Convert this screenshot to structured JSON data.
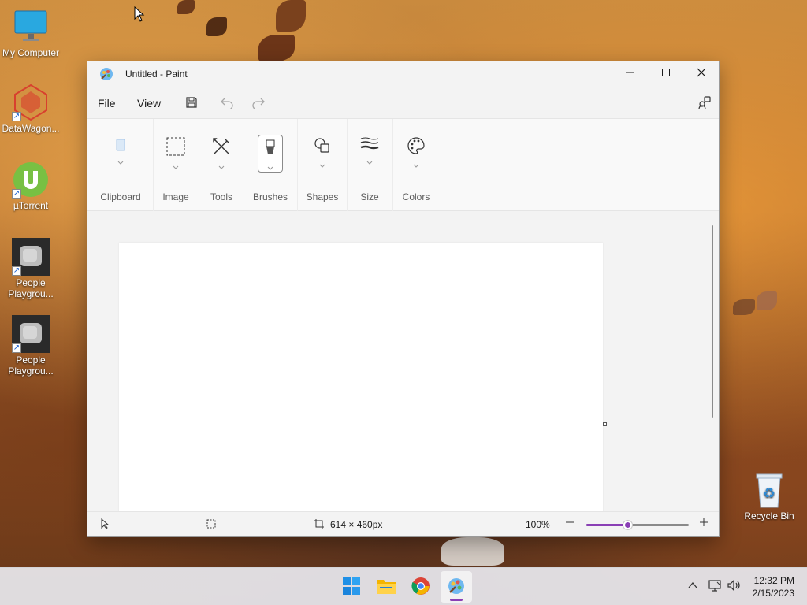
{
  "desktop": {
    "icons": [
      {
        "label": "My Computer",
        "icon": "monitor-icon"
      },
      {
        "label": "DataWagon...",
        "icon": "datawagon-icon"
      },
      {
        "label": "µTorrent",
        "icon": "utorrent-icon"
      },
      {
        "label": "People Playgrou...",
        "icon": "game-icon"
      },
      {
        "label": "People Playgrou...",
        "icon": "game-icon"
      },
      {
        "label": "Recycle Bin",
        "icon": "recycle-bin-icon"
      }
    ]
  },
  "window": {
    "title": "Untitled - Paint",
    "controls": [
      "minimize-icon",
      "maximize-icon",
      "close-icon"
    ]
  },
  "menubar": {
    "file": "File",
    "view": "View",
    "icons": [
      "save-icon",
      "undo-icon",
      "redo-icon",
      "settings-icon"
    ]
  },
  "ribbon": {
    "groups": [
      {
        "label": "Clipboard",
        "icon": "clipboard-icon"
      },
      {
        "label": "Image",
        "icon": "selection-icon"
      },
      {
        "label": "Tools",
        "icon": "tools-icon"
      },
      {
        "label": "Brushes",
        "icon": "brush-icon"
      },
      {
        "label": "Shapes",
        "icon": "shapes-icon"
      },
      {
        "label": "Size",
        "icon": "size-icon"
      },
      {
        "label": "Colors",
        "icon": "palette-icon"
      }
    ]
  },
  "statusbar": {
    "canvas_size": "614 × 460px",
    "zoom": "100%",
    "zoom_level": 0.4
  },
  "taskbar": {
    "apps": [
      "start-icon",
      "file-explorer-icon",
      "chrome-icon",
      "paint-icon"
    ],
    "active_app": "paint-icon",
    "time": "12:32 PM",
    "date": "2/15/2023"
  },
  "colors": {
    "accent": "#8a3fb5",
    "window_bg": "#f3f3f3",
    "canvas": "#ffffff"
  }
}
